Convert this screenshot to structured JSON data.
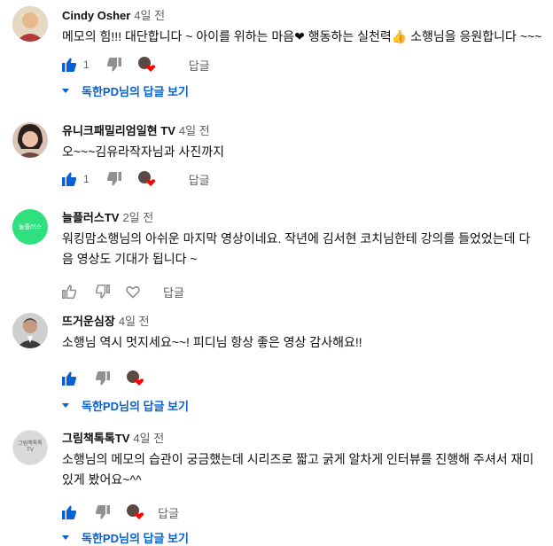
{
  "comments": [
    {
      "author": "Cindy Osher",
      "time": "4일 전",
      "text": "메모의 힘!!! 대단합니다 ~  아이를 위하는 마음❤  행동하는 실천력👍  소행님을 응원합니다 ~~~",
      "likes": "1",
      "reply_label": "답글",
      "replies_label": "독한PD님의 답글 보기",
      "avatar_bg": "#c8b6a0"
    },
    {
      "author": "유니크패밀리엄일현 TV",
      "time": "4일 전",
      "text": "오~~~김유라작자님과 사진까지",
      "likes": "1",
      "reply_label": "답글",
      "avatar_bg": "#b99a86"
    },
    {
      "author": "늘플러스TV",
      "time": "2일 전",
      "text": "워킹맘소행님의 아쉬운 마지막 영상이네요. 작년에 김서현 코치님한테 강의를 들었었는데 다음 영상도 기대가 됩니다 ~",
      "reply_label": "답글",
      "avatar_text": "늘플러스",
      "avatar_bg": "#2fe07e"
    },
    {
      "author": "뜨거운심장",
      "time": "4일 전",
      "text": "소행님 역시 멋지세요~~! 피디님 항상 좋은 영상 감사해요!!",
      "replies_label": "독한PD님의 답글 보기",
      "avatar_bg": "#a7a7a7"
    },
    {
      "author": "그림책톡톡TV",
      "time": "4일 전",
      "text": "소행님의 메모의 습관이 궁금했는데 시리즈로 짧고 굵게 알차게 인터뷰를 진행해 주셔서 재미있게 봤어요~^^",
      "reply_label": "답글",
      "replies_label": "독한PD님의 답글 보기",
      "avatar_text": "그림책톡톡",
      "avatar_subtext": "TV",
      "avatar_bg": "#d9d9d9"
    }
  ],
  "colors": {
    "link_blue": "#065fd4",
    "liked_blue": "#065fd4",
    "icon_gray": "#909090",
    "heart_red": "#ff0000"
  }
}
